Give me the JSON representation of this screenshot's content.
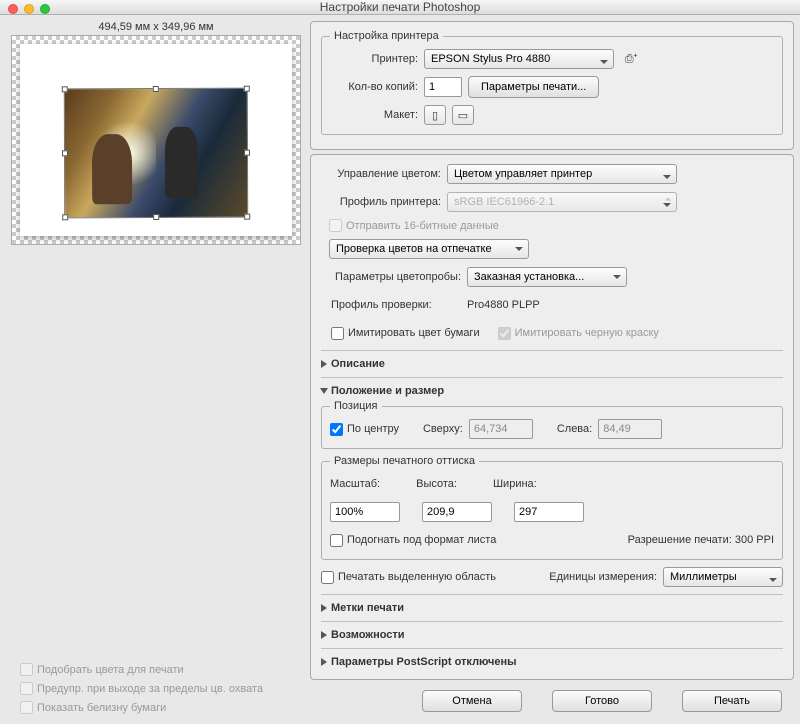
{
  "window": {
    "title": "Настройки печати Photoshop"
  },
  "canvas": {
    "dimensions": "494,59 мм x 349,96 мм"
  },
  "leftChecks": {
    "matchColors": "Подобрать цвета для печати",
    "gamutWarn": "Предупр. при выходе за пределы цв. охвата",
    "paperWhite": "Показать белизну бумаги"
  },
  "printerSetup": {
    "legend": "Настройка принтера",
    "printerLabel": "Принтер:",
    "printerValue": "EPSON Stylus Pro 4880",
    "copiesLabel": "Кол-во копий:",
    "copiesValue": "1",
    "paramsBtn": "Параметры печати...",
    "layoutLabel": "Макет:"
  },
  "colorMgmt": {
    "label": "Управление цветом:",
    "value": "Цветом управляет принтер",
    "profileLabel": "Профиль принтера:",
    "profileValue": "sRGB IEC61966-2.1",
    "send16": "Отправить 16-битные данные",
    "softproof": "Проверка цветов на отпечатке",
    "proofParamsLabel": "Параметры цветопробы:",
    "proofParamsValue": "Заказная установка...",
    "proofProfileLabel": "Профиль проверки:",
    "proofProfileValue": "Pro4880 PLPP",
    "simPaper": "Имитировать цвет бумаги",
    "simInk": "Имитировать черную краску"
  },
  "sections": {
    "description": "Описание",
    "position": "Положение и размер",
    "marks": "Метки печати",
    "options": "Возможности",
    "postscript": "Параметры PostScript отключены"
  },
  "position": {
    "posLegend": "Позиция",
    "center": "По центру",
    "topLabel": "Сверху:",
    "topValue": "64,734",
    "leftLabel": "Слева:",
    "leftValue": "84,49",
    "sizeLegend": "Размеры печатного оттиска",
    "scaleLabel": "Масштаб:",
    "scaleValue": "100%",
    "heightLabel": "Высота:",
    "heightValue": "209,9",
    "widthLabel": "Ширина:",
    "widthValue": "297",
    "fitMedia": "Подогнать под формат листа",
    "resLabel": "Разрешение печати:",
    "resValue": "300 PPI",
    "printSelected": "Печатать выделенную область",
    "unitsLabel": "Единицы измерения:",
    "unitsValue": "Миллиметры"
  },
  "buttons": {
    "cancel": "Отмена",
    "done": "Готово",
    "print": "Печать"
  }
}
